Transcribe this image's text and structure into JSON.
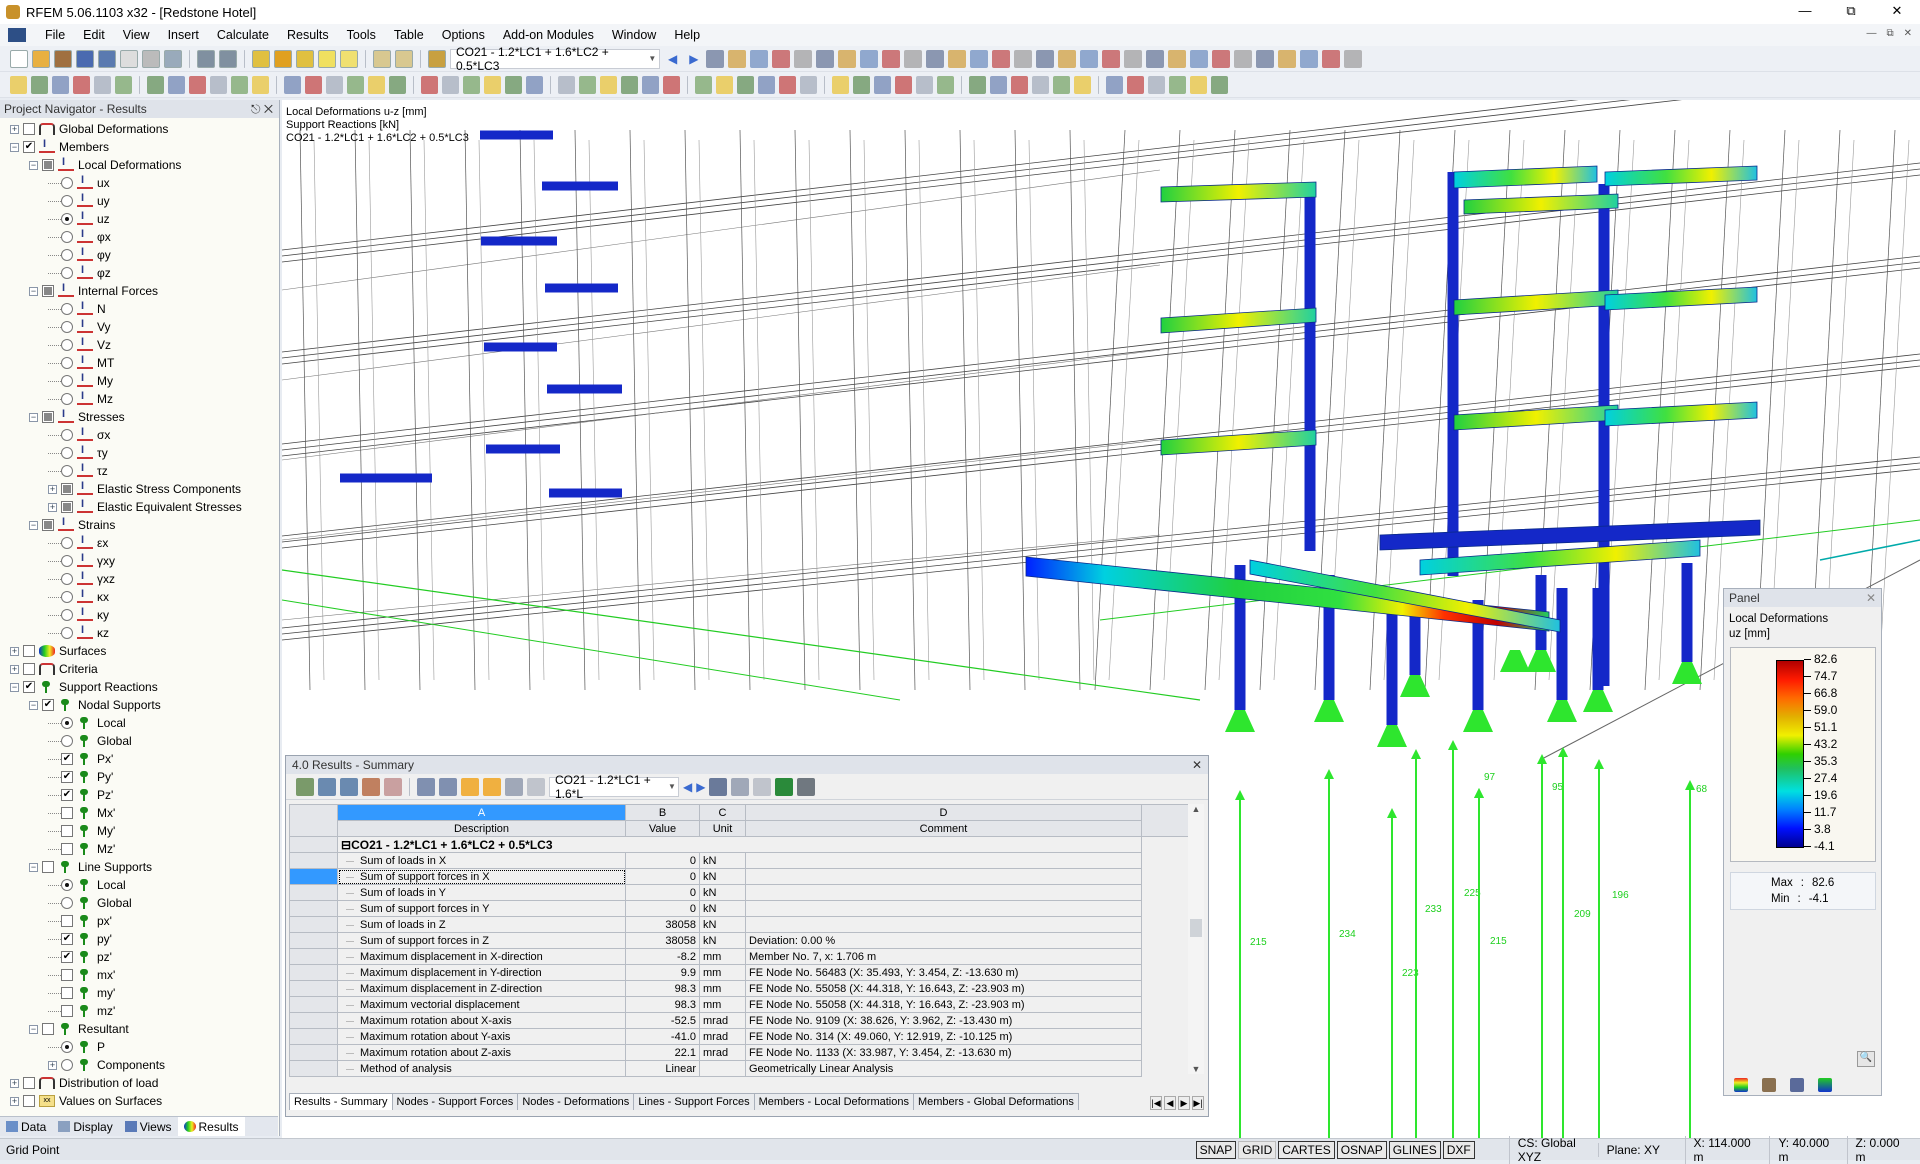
{
  "window": {
    "title": "RFEM 5.06.1103 x32 - [Redstone Hotel]"
  },
  "menu": [
    "File",
    "Edit",
    "View",
    "Insert",
    "Calculate",
    "Results",
    "Tools",
    "Table",
    "Options",
    "Add-on Modules",
    "Window",
    "Help"
  ],
  "toolbar": {
    "load_combo": "CO21 - 1.2*LC1 + 1.6*LC2 + 0.5*LC3"
  },
  "navigator": {
    "title": "Project Navigator - Results",
    "items": [
      {
        "level": 0,
        "exp": "+",
        "ctl": "check",
        "state": "off",
        "icon": "def",
        "label": "Global Deformations"
      },
      {
        "level": 0,
        "exp": "-",
        "ctl": "check",
        "state": "on",
        "icon": "mem",
        "label": "Members"
      },
      {
        "level": 1,
        "exp": "-",
        "ctl": "check",
        "state": "partial",
        "icon": "mem",
        "label": "Local Deformations"
      },
      {
        "level": 2,
        "ctl": "radio",
        "state": "off",
        "icon": "mem",
        "label": "ux"
      },
      {
        "level": 2,
        "ctl": "radio",
        "state": "off",
        "icon": "mem",
        "label": "uy"
      },
      {
        "level": 2,
        "ctl": "radio",
        "state": "on",
        "icon": "mem",
        "label": "uz"
      },
      {
        "level": 2,
        "ctl": "radio",
        "state": "off",
        "icon": "mem",
        "label": "φx"
      },
      {
        "level": 2,
        "ctl": "radio",
        "state": "off",
        "icon": "mem",
        "label": "φy"
      },
      {
        "level": 2,
        "ctl": "radio",
        "state": "off",
        "icon": "mem",
        "label": "φz"
      },
      {
        "level": 1,
        "exp": "-",
        "ctl": "check",
        "state": "partial",
        "icon": "mem",
        "label": "Internal Forces"
      },
      {
        "level": 2,
        "ctl": "radio",
        "state": "off",
        "icon": "mem",
        "label": "N"
      },
      {
        "level": 2,
        "ctl": "radio",
        "state": "off",
        "icon": "mem",
        "label": "Vy"
      },
      {
        "level": 2,
        "ctl": "radio",
        "state": "off",
        "icon": "mem",
        "label": "Vz"
      },
      {
        "level": 2,
        "ctl": "radio",
        "state": "off",
        "icon": "mem",
        "label": "MT"
      },
      {
        "level": 2,
        "ctl": "radio",
        "state": "off",
        "icon": "mem",
        "label": "My"
      },
      {
        "level": 2,
        "ctl": "radio",
        "state": "off",
        "icon": "mem",
        "label": "Mz"
      },
      {
        "level": 1,
        "exp": "-",
        "ctl": "check",
        "state": "partial",
        "icon": "mem",
        "label": "Stresses"
      },
      {
        "level": 2,
        "ctl": "radio",
        "state": "off",
        "icon": "mem",
        "label": "σx"
      },
      {
        "level": 2,
        "ctl": "radio",
        "state": "off",
        "icon": "mem",
        "label": "τy"
      },
      {
        "level": 2,
        "ctl": "radio",
        "state": "off",
        "icon": "mem",
        "label": "τz"
      },
      {
        "level": 2,
        "exp": "+",
        "ctl": "check",
        "state": "partial",
        "icon": "mem",
        "label": "Elastic Stress Components"
      },
      {
        "level": 2,
        "exp": "+",
        "ctl": "check",
        "state": "partial",
        "icon": "mem",
        "label": "Elastic Equivalent Stresses"
      },
      {
        "level": 1,
        "exp": "-",
        "ctl": "check",
        "state": "partial",
        "icon": "mem",
        "label": "Strains"
      },
      {
        "level": 2,
        "ctl": "radio",
        "state": "off",
        "icon": "mem",
        "label": "εx"
      },
      {
        "level": 2,
        "ctl": "radio",
        "state": "off",
        "icon": "mem",
        "label": "γxy"
      },
      {
        "level": 2,
        "ctl": "radio",
        "state": "off",
        "icon": "mem",
        "label": "γxz"
      },
      {
        "level": 2,
        "ctl": "radio",
        "state": "off",
        "icon": "mem",
        "label": "κx"
      },
      {
        "level": 2,
        "ctl": "radio",
        "state": "off",
        "icon": "mem",
        "label": "κy"
      },
      {
        "level": 2,
        "ctl": "radio",
        "state": "off",
        "icon": "mem",
        "label": "κz"
      },
      {
        "level": 0,
        "exp": "+",
        "ctl": "check",
        "state": "off",
        "icon": "surf",
        "label": "Surfaces"
      },
      {
        "level": 0,
        "exp": "+",
        "ctl": "check",
        "state": "off",
        "icon": "def",
        "label": "Criteria"
      },
      {
        "level": 0,
        "exp": "-",
        "ctl": "check",
        "state": "on",
        "icon": "sup",
        "label": "Support Reactions"
      },
      {
        "level": 1,
        "exp": "-",
        "ctl": "check",
        "state": "on",
        "icon": "sup",
        "label": "Nodal Supports"
      },
      {
        "level": 2,
        "ctl": "radio",
        "state": "on",
        "icon": "sup",
        "label": "Local"
      },
      {
        "level": 2,
        "ctl": "radio",
        "state": "off",
        "icon": "sup",
        "label": "Global"
      },
      {
        "level": 2,
        "ctl": "check",
        "state": "on",
        "icon": "sup",
        "label": "Px'"
      },
      {
        "level": 2,
        "ctl": "check",
        "state": "on",
        "icon": "sup",
        "label": "Py'"
      },
      {
        "level": 2,
        "ctl": "check",
        "state": "on",
        "icon": "sup",
        "label": "Pz'"
      },
      {
        "level": 2,
        "ctl": "check",
        "state": "off",
        "icon": "sup",
        "label": "Mx'"
      },
      {
        "level": 2,
        "ctl": "check",
        "state": "off",
        "icon": "sup",
        "label": "My'"
      },
      {
        "level": 2,
        "ctl": "check",
        "state": "off",
        "icon": "sup",
        "label": "Mz'"
      },
      {
        "level": 1,
        "exp": "-",
        "ctl": "check",
        "state": "off",
        "icon": "sup",
        "label": "Line Supports"
      },
      {
        "level": 2,
        "ctl": "radio",
        "state": "on",
        "icon": "sup",
        "label": "Local"
      },
      {
        "level": 2,
        "ctl": "radio",
        "state": "off",
        "icon": "sup",
        "label": "Global"
      },
      {
        "level": 2,
        "ctl": "check",
        "state": "off",
        "icon": "sup",
        "label": "px'"
      },
      {
        "level": 2,
        "ctl": "check",
        "state": "on",
        "icon": "sup",
        "label": "py'"
      },
      {
        "level": 2,
        "ctl": "check",
        "state": "on",
        "icon": "sup",
        "label": "pz'"
      },
      {
        "level": 2,
        "ctl": "check",
        "state": "off",
        "icon": "sup",
        "label": "mx'"
      },
      {
        "level": 2,
        "ctl": "check",
        "state": "off",
        "icon": "sup",
        "label": "my'"
      },
      {
        "level": 2,
        "ctl": "check",
        "state": "off",
        "icon": "sup",
        "label": "mz'"
      },
      {
        "level": 1,
        "exp": "-",
        "ctl": "check",
        "state": "off",
        "icon": "sup",
        "label": "Resultant"
      },
      {
        "level": 2,
        "ctl": "radio",
        "state": "on",
        "icon": "sup",
        "label": "P"
      },
      {
        "level": 2,
        "exp": "+",
        "ctl": "radio",
        "state": "off",
        "icon": "sup",
        "label": "Components"
      },
      {
        "level": 0,
        "exp": "+",
        "ctl": "check",
        "state": "off",
        "icon": "def",
        "label": "Distribution of load"
      },
      {
        "level": 0,
        "exp": "+",
        "ctl": "check",
        "state": "off",
        "icon": "xx",
        "label": "Values on Surfaces"
      }
    ],
    "tabs": [
      "Data",
      "Display",
      "Views",
      "Results"
    ],
    "active_tab": "Results"
  },
  "viewport": {
    "info": [
      "Local Deformations u-z [mm]",
      "Support Reactions [kN]",
      "CO21 - 1.2*LC1 + 1.6*LC2 + 0.5*LC3"
    ],
    "reaction_labels": [
      "215",
      "234",
      "223",
      "233",
      "225",
      "97",
      "215",
      "95",
      "209",
      "196",
      "68"
    ]
  },
  "results": {
    "title": "4.0 Results - Summary",
    "combo": "CO21 - 1.2*LC1 + 1.6*L",
    "col_letters": [
      "A",
      "B",
      "C",
      "D"
    ],
    "col_headers": [
      "Description",
      "Value",
      "Unit",
      "Comment"
    ],
    "group": "CO21 - 1.2*LC1 + 1.6*LC2 + 0.5*LC3",
    "rows": [
      [
        "Sum of loads in X",
        "0",
        "kN",
        ""
      ],
      [
        "Sum of support forces in X",
        "0",
        "kN",
        ""
      ],
      [
        "Sum of loads in Y",
        "0",
        "kN",
        ""
      ],
      [
        "Sum of support forces in Y",
        "0",
        "kN",
        ""
      ],
      [
        "Sum of loads in Z",
        "38058",
        "kN",
        ""
      ],
      [
        "Sum of support forces in Z",
        "38058",
        "kN",
        "Deviation:  0.00 %"
      ],
      [
        "Maximum displacement in X-direction",
        "-8.2",
        "mm",
        "Member No. 7,  x: 1.706 m"
      ],
      [
        "Maximum displacement in Y-direction",
        "9.9",
        "mm",
        "FE Node No. 56483  (X: 35.493,  Y: 3.454,  Z: -13.630 m)"
      ],
      [
        "Maximum displacement in Z-direction",
        "98.3",
        "mm",
        "FE Node No. 55058  (X: 44.318,  Y: 16.643,  Z: -23.903 m)"
      ],
      [
        "Maximum vectorial displacement",
        "98.3",
        "mm",
        "FE Node No. 55058  (X: 44.318,  Y: 16.643,  Z: -23.903 m)"
      ],
      [
        "Maximum rotation about X-axis",
        "-52.5",
        "mrad",
        "FE Node No. 9109  (X: 38.626,  Y: 3.962,  Z: -13.430 m)"
      ],
      [
        "Maximum rotation about Y-axis",
        "-41.0",
        "mrad",
        "FE Node No. 314  (X: 49.060,  Y: 12.919,  Z: -10.125 m)"
      ],
      [
        "Maximum rotation about Z-axis",
        "22.1",
        "mrad",
        "FE Node No. 1133  (X: 33.987,  Y: 3.454,  Z: -13.630 m)"
      ],
      [
        "Method of analysis",
        "Linear",
        "",
        "Geometrically Linear Analysis"
      ]
    ],
    "tabs": [
      "Results - Summary",
      "Nodes - Support Forces",
      "Nodes - Deformations",
      "Lines - Support Forces",
      "Members - Local Deformations",
      "Members - Global Deformations"
    ],
    "active_tab": "Results - Summary"
  },
  "panel": {
    "title": "Panel",
    "heading": "Local Deformations",
    "unit": "uz [mm]",
    "ticks": [
      "82.6",
      "74.7",
      "66.8",
      "59.0",
      "51.1",
      "43.2",
      "35.3",
      "27.4",
      "19.6",
      "11.7",
      "3.8",
      "-4.1"
    ],
    "max_label": "Max",
    "max": "82.6",
    "min_label": "Min",
    "min": "-4.1"
  },
  "status": {
    "left": "Grid Point",
    "toggles": [
      {
        "label": "SNAP",
        "on": true
      },
      {
        "label": "GRID",
        "on": false
      },
      {
        "label": "CARTES",
        "on": true
      },
      {
        "label": "OSNAP",
        "on": true
      },
      {
        "label": "GLINES",
        "on": true
      },
      {
        "label": "DXF",
        "on": true
      }
    ],
    "cs": "CS: Global XYZ",
    "plane": "Plane: XY",
    "x": "X:  114.000 m",
    "y": "Y:  40.000 m",
    "z": "Z:  0.000 m"
  }
}
